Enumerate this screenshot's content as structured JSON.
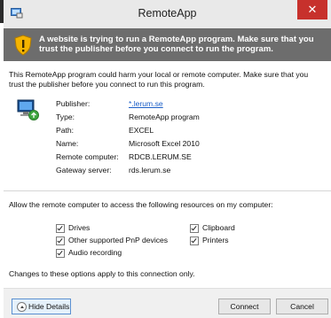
{
  "window": {
    "title": "RemoteApp",
    "close_glyph": "✕"
  },
  "banner": {
    "text": "A website is trying to run a RemoteApp program. Make sure that you trust the publisher before you connect to run the program."
  },
  "warning": "This RemoteApp program could harm your local or remote computer. Make sure that you trust the publisher before you connect to run this program.",
  "details": [
    {
      "label": "Publisher:",
      "value": "*.lerum.se",
      "is_link": true
    },
    {
      "label": "Type:",
      "value": "RemoteApp program"
    },
    {
      "label": "Path:",
      "value": "EXCEL"
    },
    {
      "label": "Name:",
      "value": "Microsoft Excel 2010"
    },
    {
      "label": "Remote computer:",
      "value": "RDCB.LERUM.SE"
    },
    {
      "label": "Gateway server:",
      "value": "rds.lerum.se"
    }
  ],
  "resources": {
    "heading": "Allow the remote computer to access the following resources on my computer:",
    "options": [
      {
        "label": "Drives",
        "checked": true
      },
      {
        "label": "Clipboard",
        "checked": true
      },
      {
        "label": "Other supported PnP devices",
        "checked": true
      },
      {
        "label": "Printers",
        "checked": true
      },
      {
        "label": "Audio recording",
        "checked": true
      }
    ]
  },
  "changes_note": "Changes to these options apply to this connection only.",
  "buttons": {
    "hide_details": "Hide Details",
    "connect": "Connect",
    "cancel": "Cancel"
  },
  "icons": {
    "title": "remoteapp-icon",
    "banner": "shield-warning-icon",
    "publisher": "remote-computer-icon"
  },
  "colors": {
    "banner_bg": "#6d6d6d",
    "close_bg": "#c7312c",
    "link": "#1a5ec7"
  }
}
